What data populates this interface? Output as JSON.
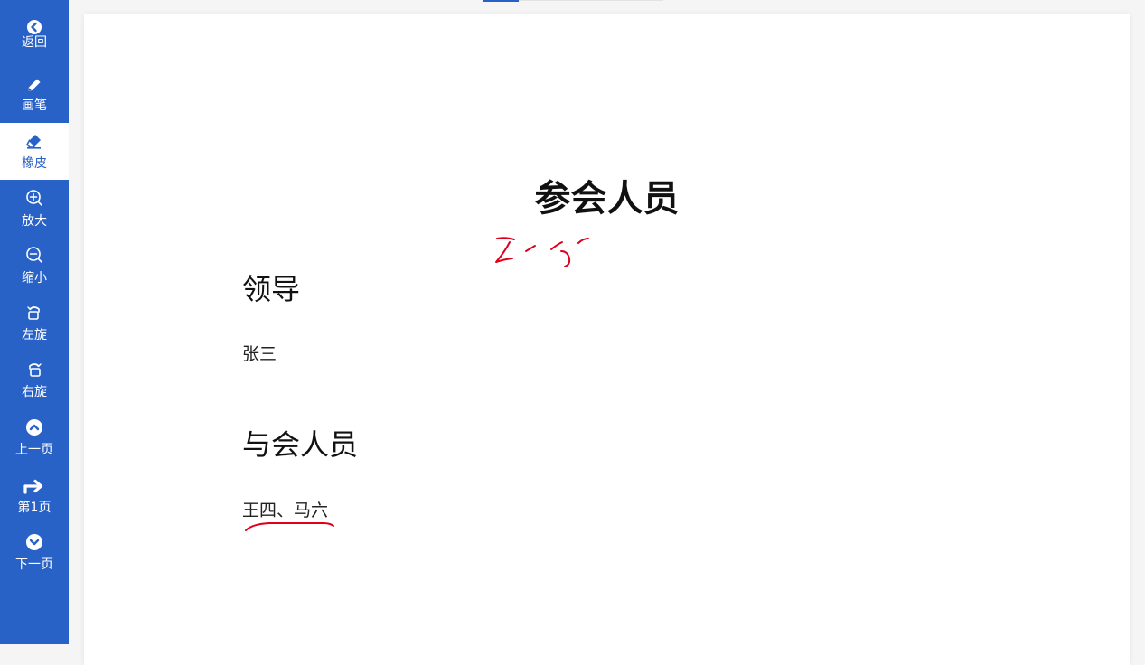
{
  "sidebar": {
    "items": [
      {
        "label": "返回",
        "icon": "chevron-left-circle-icon"
      },
      {
        "label": "画笔",
        "icon": "pencil-icon"
      },
      {
        "label": "橡皮",
        "icon": "eraser-icon",
        "active": true
      },
      {
        "label": "放大",
        "icon": "zoom-in-icon"
      },
      {
        "label": "缩小",
        "icon": "zoom-out-icon"
      },
      {
        "label": "左旋",
        "icon": "rotate-left-icon"
      },
      {
        "label": "右旋",
        "icon": "rotate-right-icon"
      },
      {
        "label": "上一页",
        "icon": "chevron-up-circle-icon"
      },
      {
        "label": "第1页",
        "icon": "arrow-right-icon"
      },
      {
        "label": "下一页",
        "icon": "chevron-down-circle-icon"
      }
    ]
  },
  "document": {
    "title": "参会人员",
    "sections": [
      {
        "heading": "领导",
        "content": "张三"
      },
      {
        "heading": "与会人员",
        "content": "王四、马六"
      }
    ]
  },
  "colors": {
    "sidebar_bg": "#2962c7",
    "active_bg": "#ffffff",
    "ink": "#e0001b"
  }
}
